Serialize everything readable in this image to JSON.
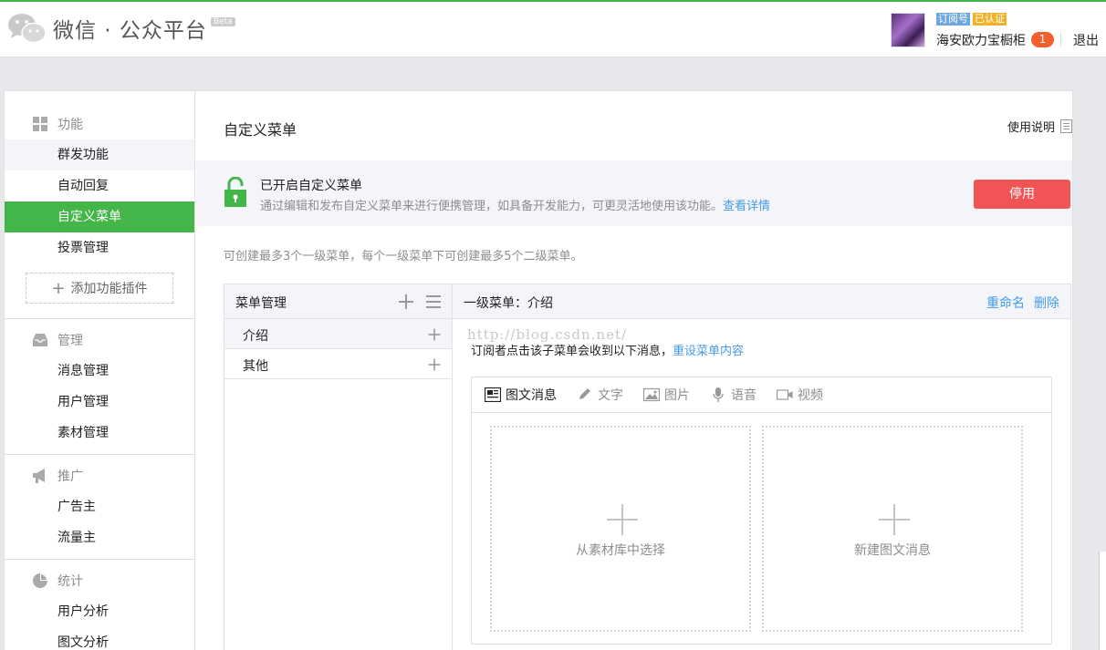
{
  "header": {
    "logo_title": "微信 · 公众平台",
    "beta": "Beta",
    "account": {
      "tag_subscription": "订阅号",
      "tag_verified": "已认证",
      "name": "海安欧力宝橱柜",
      "notifications": "1"
    },
    "logout": "退出"
  },
  "sidebar": {
    "groups": [
      {
        "title": "功能",
        "icon": "grid-icon",
        "items": [
          "群发功能",
          "自动回复",
          "自定义菜单",
          "投票管理"
        ],
        "add_plugin": "添加功能插件"
      },
      {
        "title": "管理",
        "icon": "inbox-icon",
        "items": [
          "消息管理",
          "用户管理",
          "素材管理"
        ]
      },
      {
        "title": "推广",
        "icon": "megaphone-icon",
        "items": [
          "广告主",
          "流量主"
        ]
      },
      {
        "title": "统计",
        "icon": "pie-chart-icon",
        "items": [
          "用户分析",
          "图文分析"
        ]
      }
    ],
    "active_item": "自定义菜单",
    "hover_item": "群发功能"
  },
  "main": {
    "title": "自定义菜单",
    "help": "使用说明",
    "status": {
      "title": "已开启自定义菜单",
      "desc": "通过编辑和发布自定义菜单来进行便携管理，如具备开发能力，可更灵活地使用该功能。",
      "desc_link": "查看详情",
      "disable_button": "停用"
    },
    "tip": "可创建最多3个一级菜单，每个一级菜单下可创建最多5个二级菜单。",
    "menu_panel": {
      "header": "菜单管理",
      "items": [
        "介绍",
        "其他"
      ],
      "selected": "介绍"
    },
    "detail": {
      "header": "一级菜单：介绍",
      "rename": "重命名",
      "delete": "删除",
      "watermark": "http://blog.csdn.net/",
      "hint": "订阅者点击该子菜单会收到以下消息，",
      "hint_link": "重设菜单内容",
      "tabs": [
        "图文消息",
        "文字",
        "图片",
        "语音",
        "视频"
      ],
      "active_tab": "图文消息",
      "cards": [
        "从素材库中选择",
        "新建图文消息"
      ]
    }
  },
  "colors": {
    "brand_green": "#44b549",
    "danger_red": "#f05454",
    "link_blue": "#459ae9",
    "badge_orange": "#f35e2f"
  }
}
